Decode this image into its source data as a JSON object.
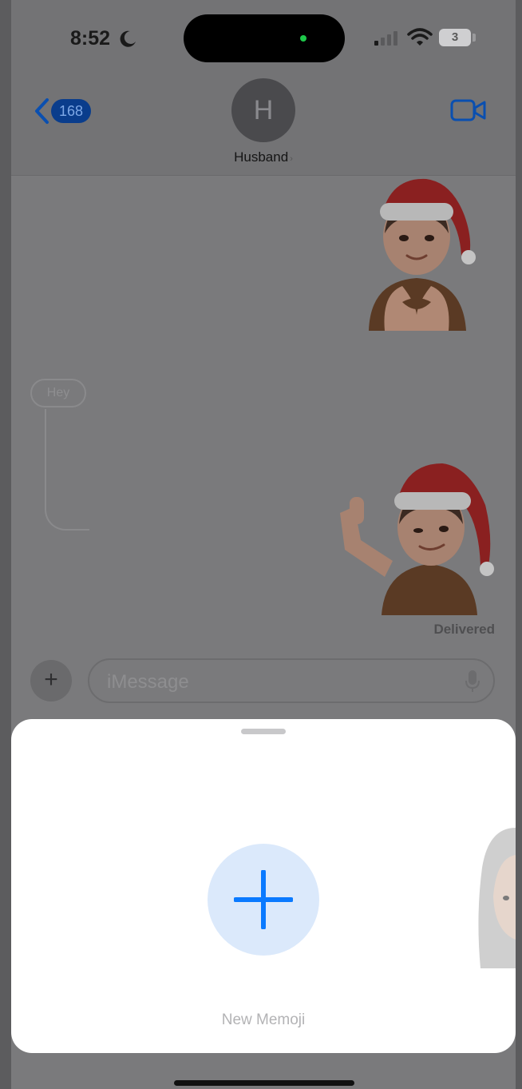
{
  "status_bar": {
    "time": "8:52",
    "battery_level": "3",
    "icons": [
      "moon-icon",
      "signal-icon",
      "wifi-icon",
      "battery-icon"
    ]
  },
  "header": {
    "back_badge_count": "168",
    "avatar_initial": "H",
    "contact_name": "Husband",
    "name_chevron": "›",
    "icons": [
      "back-chevron-icon",
      "video-call-icon"
    ]
  },
  "conversation": {
    "hey_reply": "Hey",
    "delivered_status": "Delivered",
    "stickers": [
      "memoji-heart-hands-santa-hat",
      "memoji-call-me-santa-hat"
    ]
  },
  "input_bar": {
    "plus_label": "+",
    "placeholder": "iMessage",
    "icons": [
      "plus-icon",
      "microphone-icon"
    ]
  },
  "memoji_sheet": {
    "new_memoji_label": "New Memoji",
    "icons": [
      "plus-large-icon"
    ]
  },
  "colors": {
    "accent_blue": "#0a7aff",
    "new_memoji_circle": "#dbe9fb",
    "dim_overlay": "#7a7a7c",
    "sheet_background": "#ffffff"
  }
}
